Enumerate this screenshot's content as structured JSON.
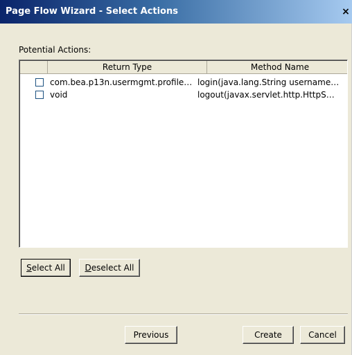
{
  "window": {
    "title": "Page Flow Wizard - Select Actions",
    "close_glyph": "×"
  },
  "actions_panel": {
    "label": "Potential Actions:",
    "columns": [
      "",
      "Return Type",
      "Method Name"
    ],
    "rows": [
      {
        "checked": false,
        "return_type": "com.bea.p13n.usermgmt.profile…",
        "method_name": "login(java.lang.String username…"
      },
      {
        "checked": false,
        "return_type": "void",
        "method_name": "logout(javax.servlet.http.HttpS…"
      }
    ]
  },
  "selection_buttons": {
    "select_all_mnemonic": "S",
    "select_all_rest": "elect All",
    "deselect_all_mnemonic": "D",
    "deselect_all_rest": "eselect All"
  },
  "footer_buttons": {
    "previous": "Previous",
    "create": "Create",
    "cancel": "Cancel"
  }
}
